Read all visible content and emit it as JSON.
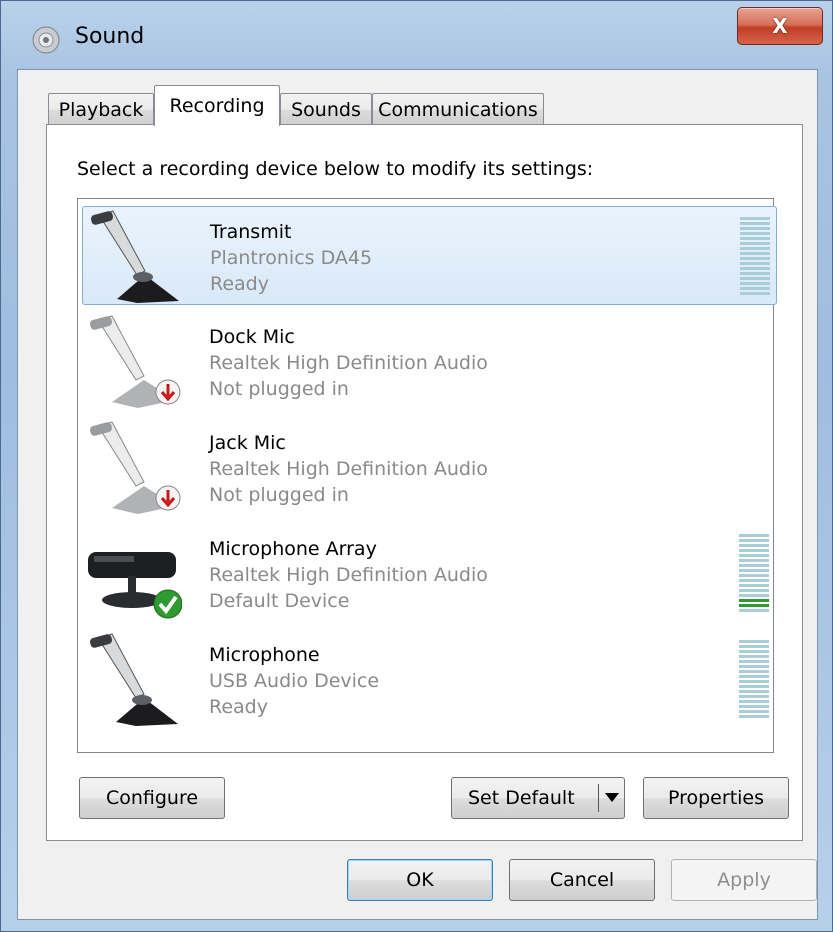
{
  "window": {
    "title": "Sound",
    "close_label": "X"
  },
  "tabs": [
    {
      "label": "Playback"
    },
    {
      "label": "Recording"
    },
    {
      "label": "Sounds"
    },
    {
      "label": "Communications"
    }
  ],
  "instruction": "Select a recording device below to modify its settings:",
  "devices": [
    {
      "name": "Transmit",
      "driver": "Plantronics DA45",
      "status": "Ready",
      "icon": "microphone-icon",
      "selected": true,
      "level": 0
    },
    {
      "name": "Dock Mic",
      "driver": "Realtek High Definition Audio",
      "status": "Not plugged in",
      "icon": "microphone-unplugged-icon"
    },
    {
      "name": "Jack Mic",
      "driver": "Realtek High Definition Audio",
      "status": "Not plugged in",
      "icon": "microphone-unplugged-icon"
    },
    {
      "name": "Microphone Array",
      "driver": "Realtek High Definition Audio",
      "status": "Default Device",
      "icon": "microphone-array-default-icon",
      "level": 0.1
    },
    {
      "name": "Microphone",
      "driver": "USB Audio Device",
      "status": "Ready",
      "icon": "microphone-icon",
      "level": 0
    }
  ],
  "buttons": {
    "configure": "Configure",
    "set_default": "Set Default",
    "properties": "Properties",
    "ok": "OK",
    "cancel": "Cancel",
    "apply": "Apply"
  },
  "colors": {
    "selection_border": "#84acdd",
    "meter_idle": "#a8cdd6",
    "meter_active": "#2f9a2f",
    "close_button": "#c23d25"
  }
}
